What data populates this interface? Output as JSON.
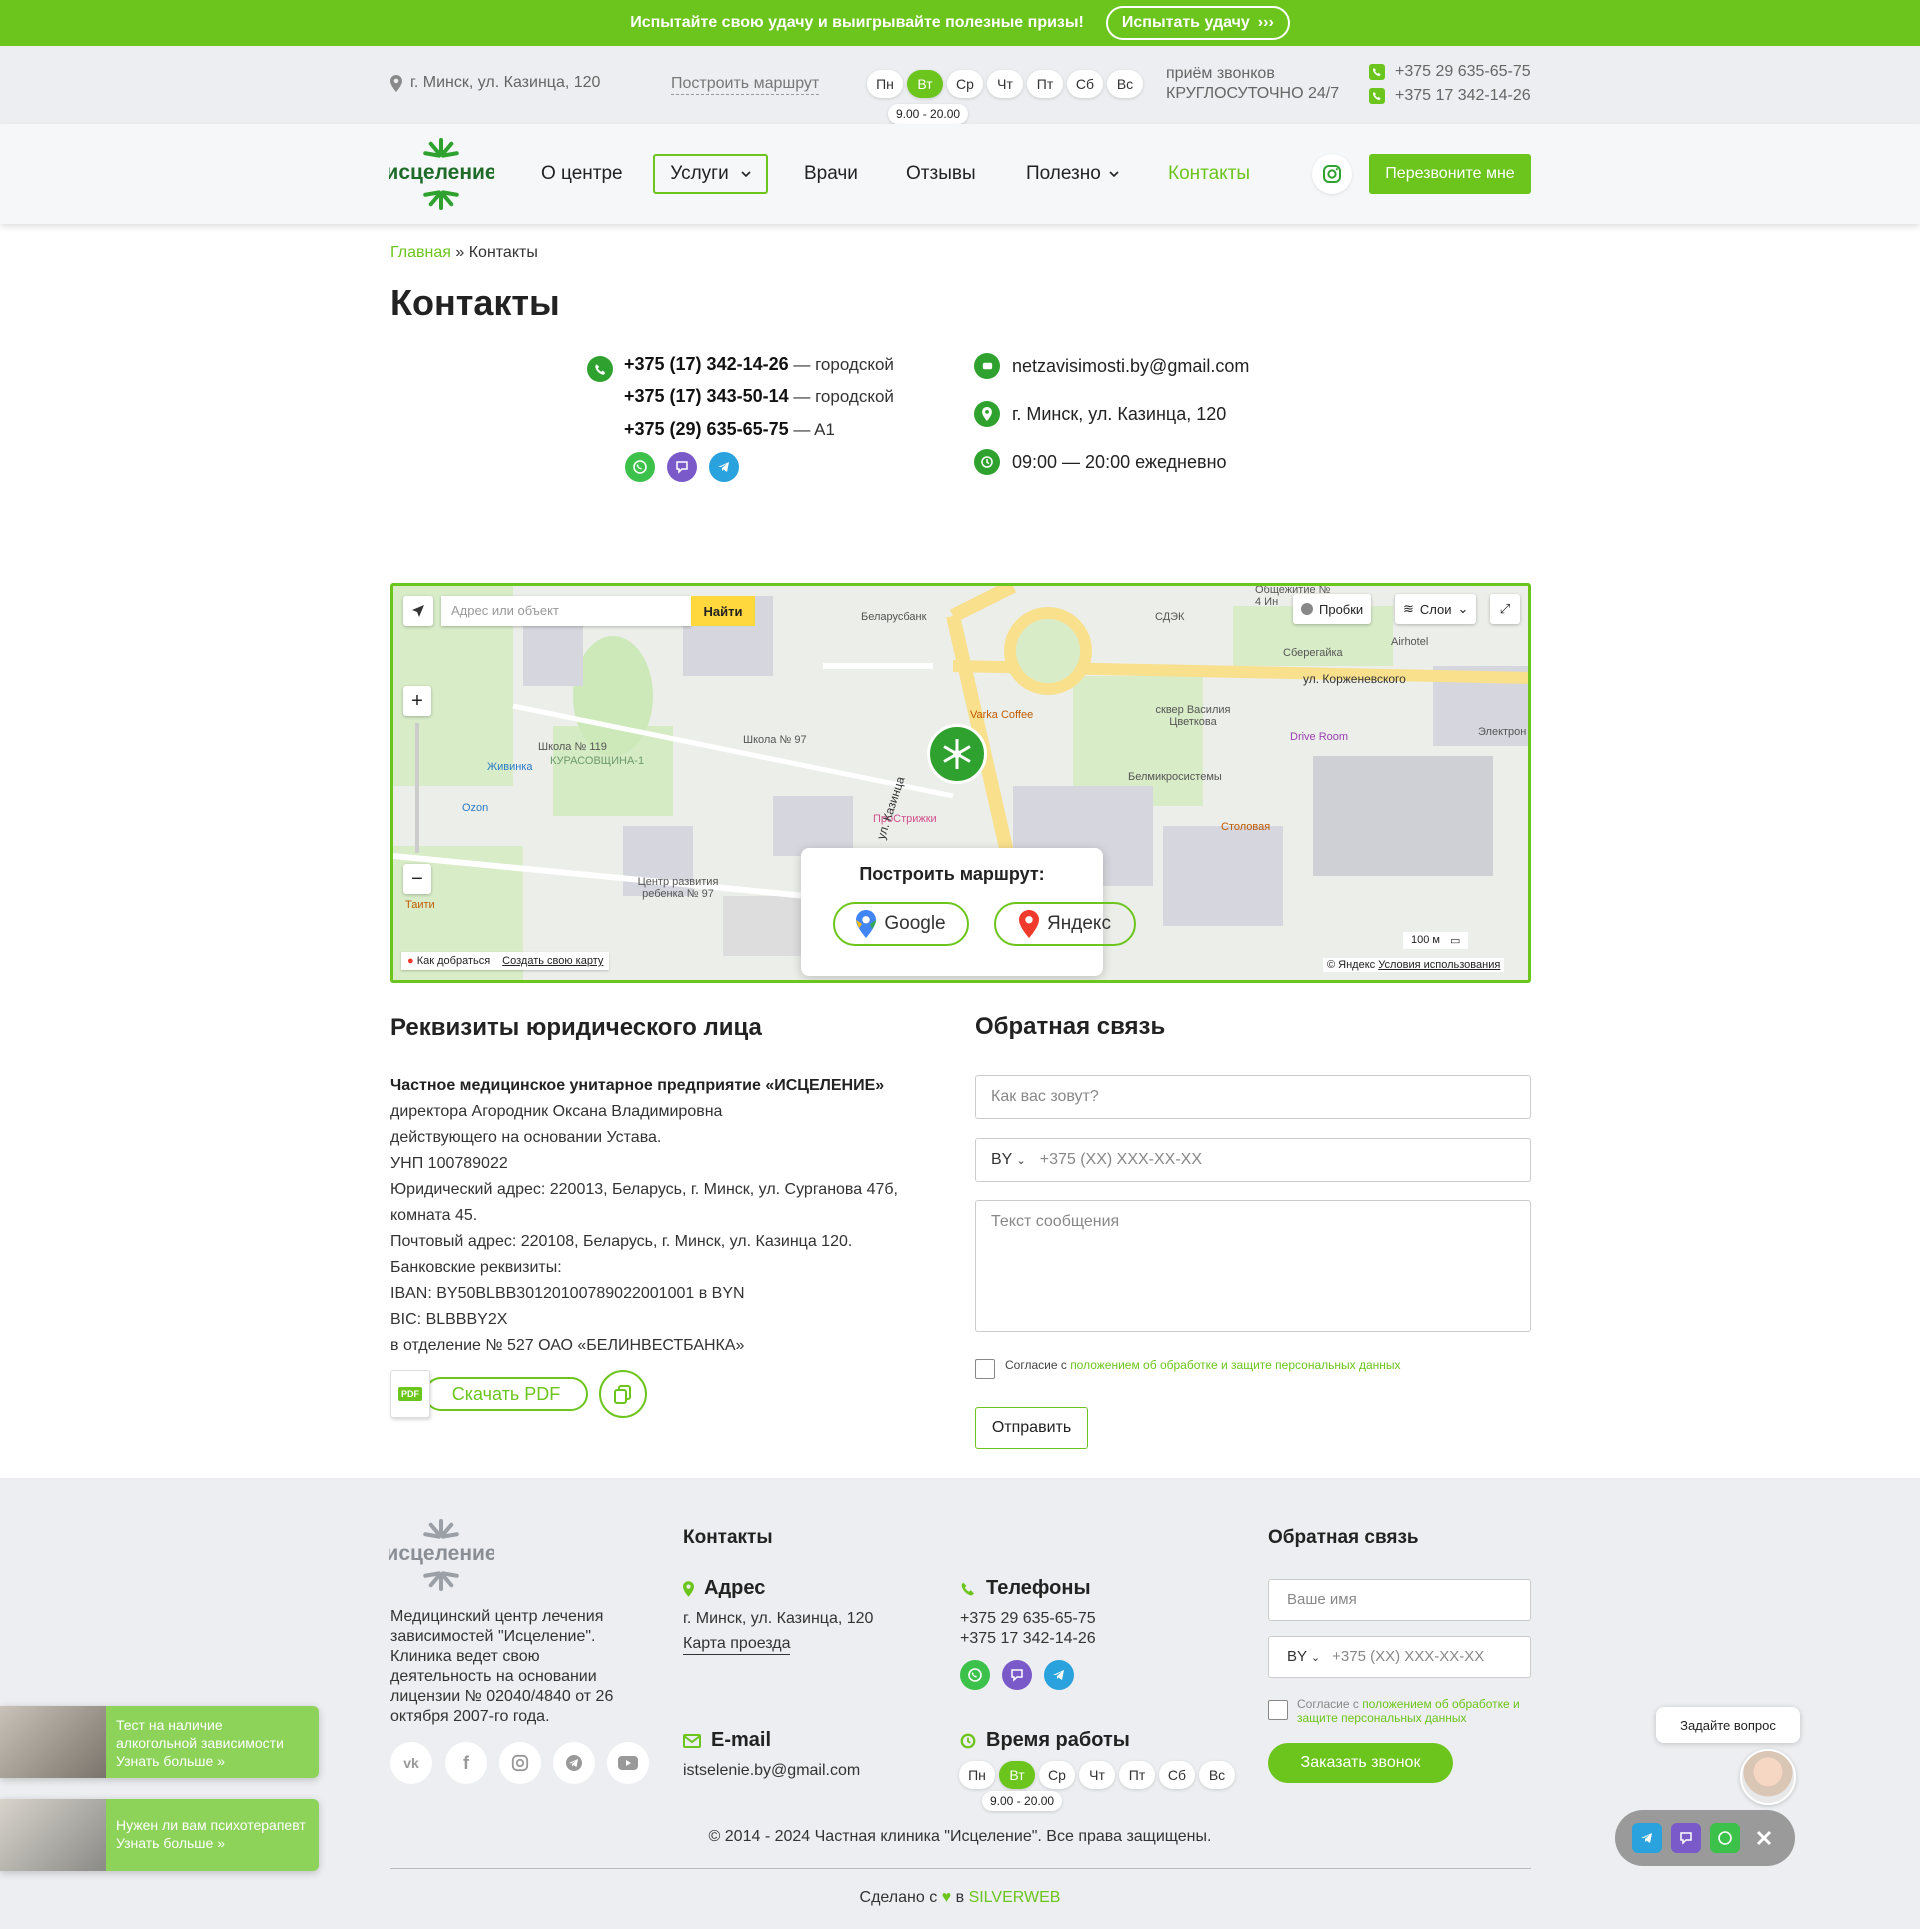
{
  "promo": {
    "text": "Испытайте свою удачу и выигрывайте полезные призы!",
    "button": "Испытать удачу"
  },
  "topbar": {
    "address": "г. Минск, ул. Казинца, 120",
    "route": "Построить маршрут",
    "days": [
      "Пн",
      "Вт",
      "Ср",
      "Чт",
      "Пт",
      "Сб",
      "Вс"
    ],
    "active_day": "Вт",
    "hours": "9.00 - 20.00",
    "calls_line1": "приём звонков",
    "calls_line2": "КРУГЛОСУТОЧНО 24/7",
    "phone1": "+375 29 635-65-75",
    "phone2": "+375 17 342-14-26"
  },
  "nav": {
    "logo_text": "исцеление",
    "items": [
      "О центре",
      "Услуги",
      "Врачи",
      "Отзывы",
      "Полезно",
      "Контакты"
    ],
    "callback": "Перезвоните мне"
  },
  "breadcrumbs": {
    "home": "Главная",
    "sep": "»",
    "current": "Контакты"
  },
  "page_title": "Контакты",
  "contacts": {
    "phones": [
      {
        "number": "+375 (17) 342-14-26",
        "note": "— городской"
      },
      {
        "number": "+375 (17) 343-50-14",
        "note": "— городской"
      },
      {
        "number": "+375 (29) 635-65-75",
        "note": "— A1"
      }
    ],
    "email": "netzavisimosti.by@gmail.com",
    "address": "г. Минск, ул. Казинца, 120",
    "hours": "09:00 — 20:00 ежедневно"
  },
  "map": {
    "search_placeholder": "Адрес или объект",
    "find": "Найти",
    "traffic": "Пробки",
    "layers": "Слои",
    "route_title": "Построить маршрут:",
    "google": "Google",
    "yandex": "Яндекс",
    "how_to": "Как добраться",
    "create_map": "Создать свою карту",
    "scale": "100 м",
    "copyright_yandex": "© Яндекс",
    "terms": "Условия использования",
    "labels": {
      "belarusbank": "Беларусбанк",
      "sdek": "СДЭК",
      "obshchezhitie": "Общежитие № 4 Ин",
      "airhotel": "Airhotel",
      "sberegaika": "Сберегайка",
      "korzhenevskogo": "ул. Корженевского",
      "varka": "Varka Coffee",
      "skver": "сквер Василия Цветкова",
      "drive": "Drive Room",
      "shkola119": "Школа № 119",
      "kurasovshchina": "КУРАСОВЩИНА-1",
      "shkola97": "Школа № 97",
      "zhivinka": "Живинка",
      "ozon": "Ozon",
      "prostrizhki": "ПроСтрижки",
      "kazintsa": "ул. Казинца",
      "belmikro": "Белмикросистемы",
      "stolovaya": "Столовая",
      "centr": "Центр развития ребенка № 97",
      "taiti": "Таити",
      "elektron": "Электрон"
    }
  },
  "requisites": {
    "title": "Реквизиты юридического лица",
    "company": "Частное медицинское унитарное предприятие «ИСЦЕЛЕНИЕ»",
    "lines": [
      "директора Агородник Оксана Владимировна",
      "действующего на основании Устава.",
      "УНП 100789022",
      "Юридический адрес: 220013, Беларусь, г. Минск, ул. Сурганова 47б,",
      "комната 45.",
      "Почтовый адрес: 220108, Беларусь, г. Минск, ул. Казинца 120.",
      "Банковские реквизиты:",
      "IBAN: BY50BLBB30120100789022001001 в BYN",
      "BIC: BLBBBY2X",
      "в отделение № 527 ОАО «БЕЛИНВЕСТБАНКА»"
    ],
    "pdf": "Скачать PDF",
    "pdf_badge": "PDF"
  },
  "feedback": {
    "title": "Обратная связь",
    "name_placeholder": "Как вас зовут?",
    "country": "BY",
    "phone_placeholder": "+375 (XX) XXX-XX-XX",
    "message_placeholder": "Текст сообщения",
    "consent_prefix": "Согласие с ",
    "consent_link": "положением об обработке и защите персональных данных",
    "submit": "Отправить"
  },
  "footer": {
    "logo_text": "исцеление",
    "description": "Медицинский центр лечения зависимостей \"Исцеление\". Клиника ведет свою деятельность на основании лицензии № 02040/4840 от 26 октября 2007-го года.",
    "contacts_title": "Контакты",
    "address_title": "Адрес",
    "address": "г. Минск, ул. Казинца, 120",
    "route_link": "Карта проезда",
    "phones_title": "Телефоны",
    "phone1": "+375 29 635-65-75",
    "phone2": "+375 17 342-14-26",
    "email_title": "E-mail",
    "email": "istselenie.by@gmail.com",
    "hours_title": "Время работы",
    "feedback_title": "Обратная связь",
    "name_placeholder": "Ваше имя",
    "consent_prefix": "Согласие с ",
    "consent_link": "положением об обработке и защите персональных данных",
    "order": "Заказать звонок",
    "copyright": "© 2014 - 2024 Частная клиника \"Исцеление\". Все права защищены.",
    "made_prefix": "Сделано с",
    "made_in": "в",
    "made_by": "SILVERWEB"
  },
  "side_cards": [
    {
      "line1": "Тест на наличие",
      "line2": "алкогольной зависимости",
      "line3": "Узнать больше »"
    },
    {
      "line1": "Нужен ли вам психотерапевт",
      "line2": "Узнать больше »"
    }
  ],
  "chat": {
    "ask": "Задайте вопрос"
  },
  "colors": {
    "accent": "#6cc51c",
    "dark_green": "#2ea12e"
  }
}
